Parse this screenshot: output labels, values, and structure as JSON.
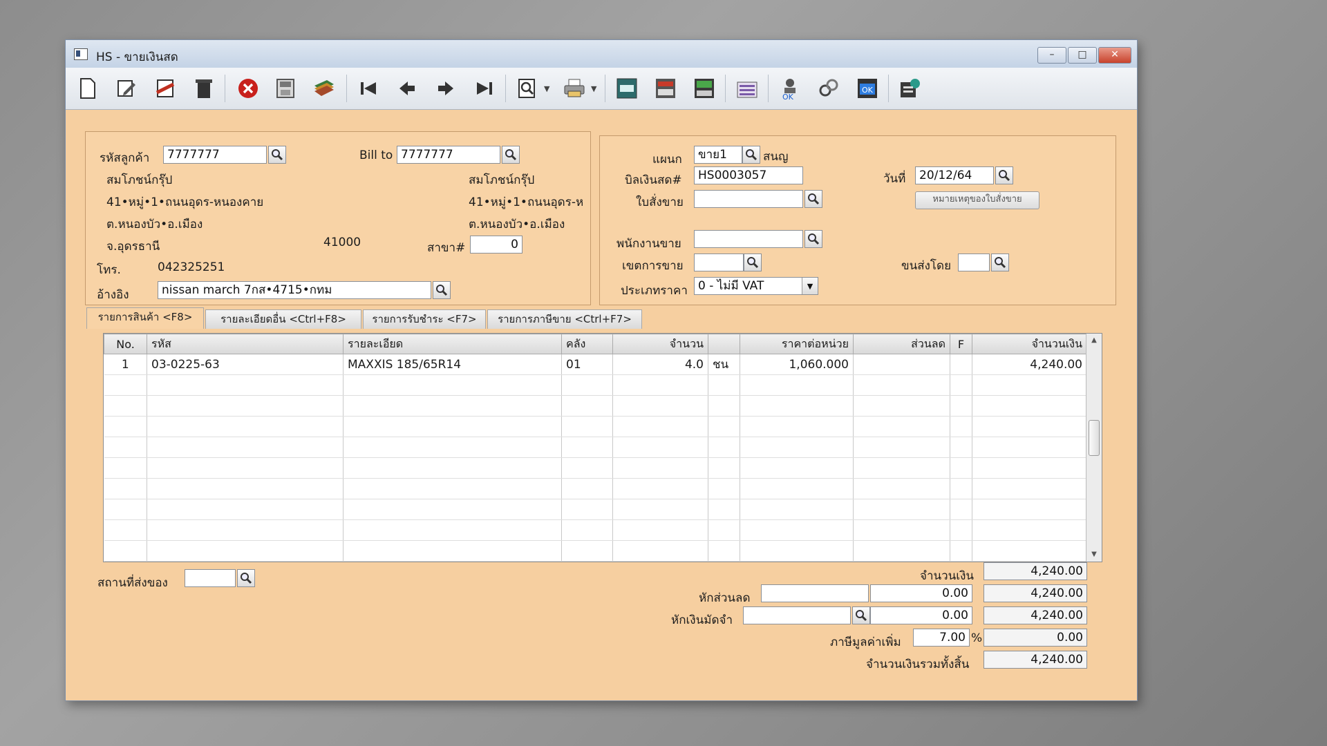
{
  "window": {
    "title": "HS - ขายเงินสด"
  },
  "toolbar": {
    "buttons": [
      {
        "name": "new-doc-icon"
      },
      {
        "name": "edit-doc-icon"
      },
      {
        "name": "void-doc-icon"
      },
      {
        "name": "trash-icon"
      },
      {
        "name": "cancel-icon"
      },
      {
        "name": "save-icon"
      },
      {
        "name": "book-icon"
      },
      {
        "name": "first-record-icon"
      },
      {
        "name": "prev-record-icon"
      },
      {
        "name": "next-record-icon"
      },
      {
        "name": "last-record-icon"
      },
      {
        "name": "find-icon"
      },
      {
        "name": "print-icon"
      },
      {
        "name": "tool-a-icon"
      },
      {
        "name": "tool-b-icon"
      },
      {
        "name": "tool-c-icon"
      },
      {
        "name": "report-icon"
      },
      {
        "name": "approve-icon"
      },
      {
        "name": "link-icon"
      },
      {
        "name": "ok-icon"
      },
      {
        "name": "exit-icon"
      }
    ]
  },
  "customer": {
    "code_label": "รหัสลูกค้า",
    "code_value": "7777777",
    "name": "สมโภชน์กรุ๊ป",
    "address1": "41•หมู่•1•ถนนอุดร-หนองคาย",
    "address2": "ต.หนองบัว•อ.เมือง",
    "province": "จ.อุดรธานี",
    "postcode": "41000",
    "phone_label": "โทร.",
    "phone": "042325251",
    "ref_label": "อ้างอิง",
    "ref_value": "nissan march 7กส•4715•กทม"
  },
  "bill_to": {
    "label": "Bill to",
    "value": "7777777",
    "name": "สมโภชน์กรุ๊ป",
    "address1": "41•หมู่•1•ถนนอุดร-ห",
    "address2": "ต.หนองบัว•อ.เมือง",
    "branch_label": "สาขา#",
    "branch_value": "0"
  },
  "doc": {
    "dept_label": "แผนก",
    "dept_value": "ขาย1",
    "dept_name": "สนญ",
    "bill_label": "บิลเงินสด#",
    "bill_value": "HS0003057",
    "so_label": "ใบสั่งขาย",
    "so_value": "",
    "date_label": "วันที่",
    "date_value": "20/12/64",
    "note_button": "หมายเหตุของใบสั่งขาย",
    "salesman_label": "พนักงานขาย",
    "salesman_value": "",
    "area_label": "เขตการขาย",
    "area_value": "",
    "shipby_label": "ขนส่งโดย",
    "shipby_value": "",
    "pricetype_label": "ประเภทราคา",
    "pricetype_value": "0 - ไม่มี VAT"
  },
  "tabs": [
    {
      "label": "รายการสินค้า <F8>"
    },
    {
      "label": "รายละเอียดอื่น <Ctrl+F8>"
    },
    {
      "label": "รายการรับชำระ <F7>"
    },
    {
      "label": "รายการภาษีขาย <Ctrl+F7>"
    }
  ],
  "grid": {
    "headers": [
      "No.",
      "รหัส",
      "รายละเอียด",
      "คลัง",
      "จำนวน",
      "",
      "ราคาต่อหน่วย",
      "ส่วนลด",
      "F",
      "จำนวนเงิน"
    ],
    "rows": [
      [
        "1",
        "03-0225-63",
        "MAXXIS 185/65R14",
        "01",
        "4.0",
        "ชน",
        "1,060.000",
        "",
        "",
        "4,240.00"
      ]
    ]
  },
  "footer": {
    "ship_place_label": "สถานที่ส่งของ",
    "ship_place_value": "",
    "amount_label": "จำนวนเงิน",
    "amount_value": "4,240.00",
    "discount_label": "หักส่วนลด",
    "discount_text": "",
    "discount_amount": "0.00",
    "discount_total": "4,240.00",
    "deposit_label": "หักเงินมัดจำ",
    "deposit_text": "",
    "deposit_amount": "0.00",
    "deposit_total": "4,240.00",
    "vat_label": "ภาษีมูลค่าเพิ่ม",
    "vat_rate": "7.00",
    "vat_pct": "%",
    "vat_amount": "0.00",
    "grand_label": "จำนวนเงินรวมทั้งสิ้น",
    "grand_value": "4,240.00"
  }
}
